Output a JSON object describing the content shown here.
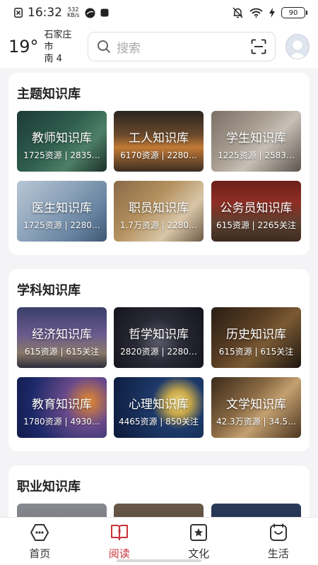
{
  "status_bar": {
    "time": "16:32",
    "net_speed_value": "532",
    "net_speed_unit": "KB/s",
    "battery": "90"
  },
  "header": {
    "temperature": "19°",
    "city": "石家庄市",
    "wind": "南 4",
    "search_placeholder": "搜索"
  },
  "sections": [
    {
      "title": "主题知识库",
      "tiles": [
        {
          "name": "教师知识库",
          "stats": "1725资源 | 2835…"
        },
        {
          "name": "工人知识库",
          "stats": "6170资源 | 2280…"
        },
        {
          "name": "学生知识库",
          "stats": "1225资源 | 2583…"
        },
        {
          "name": "医生知识库",
          "stats": "1725资源 | 2280…"
        },
        {
          "name": "职员知识库",
          "stats": "1.7万资源 | 2280…"
        },
        {
          "name": "公务员知识库",
          "stats": "615资源 | 2265关注"
        }
      ]
    },
    {
      "title": "学科知识库",
      "tiles": [
        {
          "name": "经济知识库",
          "stats": "615资源 | 615关注"
        },
        {
          "name": "哲学知识库",
          "stats": "2820资源 | 2280…"
        },
        {
          "name": "历史知识库",
          "stats": "615资源 | 615关注"
        },
        {
          "name": "教育知识库",
          "stats": "1780资源 | 4930…"
        },
        {
          "name": "心理知识库",
          "stats": "4465资源 | 850关注"
        },
        {
          "name": "文学知识库",
          "stats": "42.3万资源 | 34.5…"
        }
      ]
    },
    {
      "title": "职业知识库",
      "tiles": []
    }
  ],
  "bottom_nav": [
    {
      "label": "首页",
      "icon": "home-icon",
      "active": false
    },
    {
      "label": "阅读",
      "icon": "book-icon",
      "active": true
    },
    {
      "label": "文化",
      "icon": "star-frame-icon",
      "active": false
    },
    {
      "label": "生活",
      "icon": "life-icon",
      "active": false
    }
  ],
  "colors": {
    "accent": "#c8333a",
    "background": "#f4f4f6"
  }
}
